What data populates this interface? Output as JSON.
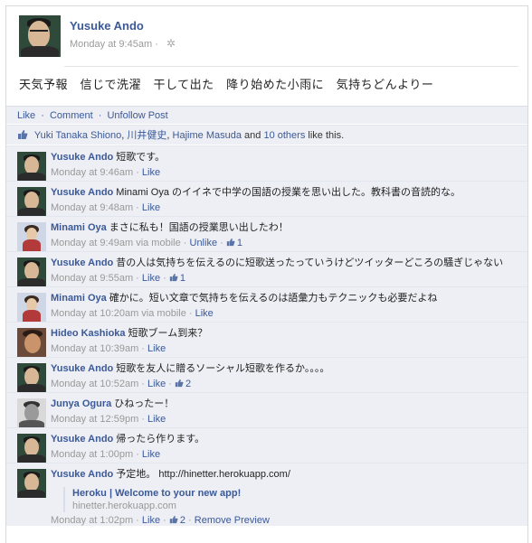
{
  "post": {
    "author": "Yusuke Ando",
    "timestamp": "Monday at 9:45am",
    "meta_sep": "·",
    "text": "天気予報　信じで洗濯　干して出た　降り始めた小雨に　気持ちどんよりー"
  },
  "actions": {
    "like": "Like",
    "comment": "Comment",
    "unfollow": "Unfollow Post",
    "sep": "·"
  },
  "likes": {
    "names": [
      "Yuki Tanaka Shiono",
      "川井健史",
      "Hajime Masuda"
    ],
    "and": "and",
    "others": "10 others",
    "suffix": "like this."
  },
  "comments": [
    {
      "author": "Yusuke Ando",
      "text": "短歌です。",
      "time": "Monday at 9:46am",
      "via": "",
      "links": [
        "Like"
      ],
      "likes": "",
      "avatar": "ya"
    },
    {
      "author": "Yusuke Ando",
      "text": "Minami Oya のイイネで中学の国語の授業を思い出した。教科書の音読的な。",
      "time": "Monday at 9:48am",
      "via": "",
      "links": [
        "Like"
      ],
      "likes": "",
      "avatar": "ya"
    },
    {
      "author": "Minami Oya",
      "text": "まさに私も！国語の授業思い出したわ！",
      "time": "Monday at 9:49am",
      "via": "via mobile",
      "links": [
        "Unlike"
      ],
      "likes": "1",
      "avatar": "mo"
    },
    {
      "author": "Yusuke Ando",
      "text": "昔の人は気持ちを伝えるのに短歌送ったっていうけどツイッターどころの騒ぎじゃない",
      "time": "Monday at 9:55am",
      "via": "",
      "links": [
        "Like"
      ],
      "likes": "1",
      "avatar": "ya"
    },
    {
      "author": "Minami Oya",
      "text": "確かに。短い文章で気持ちを伝えるのは語彙力もテクニックも必要だよね",
      "time": "Monday at 10:20am",
      "via": "via mobile",
      "links": [
        "Like"
      ],
      "likes": "",
      "avatar": "mo"
    },
    {
      "author": "Hideo Kashioka",
      "text": "短歌ブーム到来？",
      "time": "Monday at 10:39am",
      "via": "",
      "links": [
        "Like"
      ],
      "likes": "",
      "avatar": "hk"
    },
    {
      "author": "Yusuke Ando",
      "text": "短歌を友人に贈るソーシャル短歌を作るか。。。。",
      "time": "Monday at 10:52am",
      "via": "",
      "links": [
        "Like"
      ],
      "likes": "2",
      "avatar": "ya"
    },
    {
      "author": "Junya Ogura",
      "text": "ひねったー！",
      "time": "Monday at 12:59pm",
      "via": "",
      "links": [
        "Like"
      ],
      "likes": "",
      "avatar": "jo"
    },
    {
      "author": "Yusuke Ando",
      "text": "帰ったら作ります。",
      "time": "Monday at 1:00pm",
      "via": "",
      "links": [
        "Like"
      ],
      "likes": "",
      "avatar": "ya"
    },
    {
      "author": "Yusuke Ando",
      "text": "予定地。 http://hinetter.herokuapp.com/",
      "time": "Monday at 1:02pm",
      "via": "",
      "links": [
        "Like"
      ],
      "likes": "2",
      "avatar": "ya",
      "preview": {
        "title": "Heroku | Welcome to your new app!",
        "url": "hinetter.herokuapp.com",
        "remove": "Remove Preview"
      }
    }
  ],
  "colors": {
    "link": "#3b5998",
    "panel": "#edeff4",
    "muted": "#999999"
  },
  "icons": {
    "like": "thumbs-up-icon",
    "settings": "gear-icon"
  }
}
